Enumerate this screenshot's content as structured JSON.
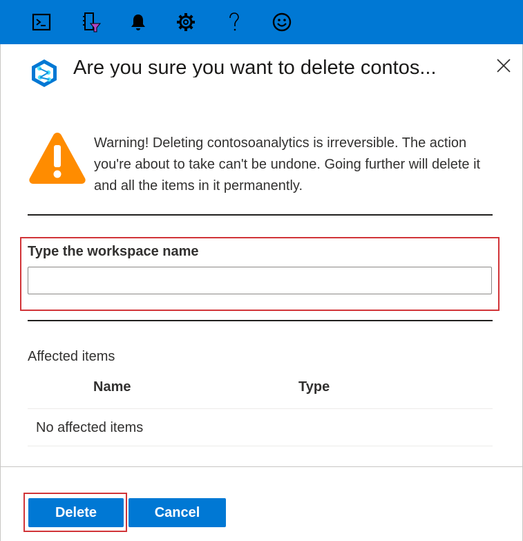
{
  "topbar": {
    "background": "#0078d4",
    "icons": [
      "cloud-shell-icon",
      "directory-filter-icon",
      "bell-icon",
      "gear-icon",
      "help-icon",
      "feedback-smiley-icon"
    ]
  },
  "dialog": {
    "title": "Are you sure you want to delete contos...",
    "logo_icon": "synapse-workspace-icon",
    "close_icon": "close-icon",
    "warning": {
      "icon": "warning-triangle-icon",
      "icon_color": "#ff8c00",
      "text": "Warning! Deleting contosoanalytics is irreversible. The action you're about to take can't be undone. Going further will delete it and all the items in it permanently."
    },
    "confirm_field": {
      "label": "Type the workspace name",
      "value": "",
      "placeholder": ""
    },
    "affected": {
      "title": "Affected items",
      "columns": [
        "Name",
        "Type"
      ],
      "empty_text": "No affected items"
    },
    "buttons": {
      "delete": "Delete",
      "cancel": "Cancel"
    },
    "highlight_color": "#d13438"
  }
}
